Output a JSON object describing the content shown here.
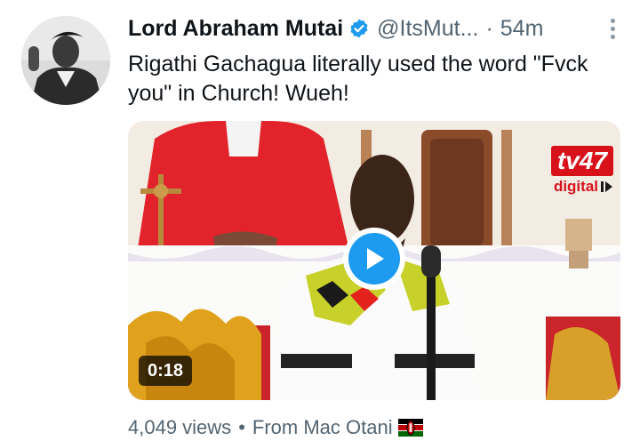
{
  "author": {
    "display_name": "Lord Abraham Mutai",
    "handle": "@ItsMut...",
    "separator": "·",
    "time": "54m"
  },
  "tweet": {
    "text": "Rigathi Gachagua literally used the word \"Fvck you\" in Church! Wueh!"
  },
  "media": {
    "duration": "0:18",
    "logo_main": "tv47",
    "logo_sub": "digital"
  },
  "footer": {
    "views": "4,049 views",
    "separator": "•",
    "source": "From Mac Otani"
  },
  "icons": {
    "verified": "verified-badge-icon",
    "more": "more-dots-icon",
    "play": "play-icon",
    "flag": "kenya-flag-icon"
  },
  "colors": {
    "verified_blue": "#1d9bf0",
    "text": "#0f1419",
    "secondary": "#536471",
    "logo_red": "#d8121a"
  }
}
